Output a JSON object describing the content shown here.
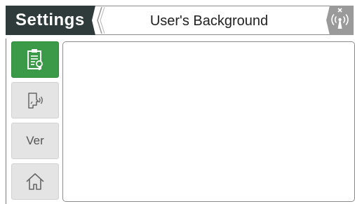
{
  "header": {
    "settings_label": "Settings",
    "page_title": "User's Background",
    "signal_icon": "signal-off-icon"
  },
  "sidebar": {
    "items": [
      {
        "icon": "clipboard-settings-icon",
        "active": true
      },
      {
        "icon": "voice-command-icon",
        "active": false
      },
      {
        "label": "Ver",
        "active": false
      },
      {
        "icon": "home-icon",
        "active": false
      }
    ]
  },
  "colors": {
    "header_dark": "#2f3a3a",
    "active_green": "#3a9a48",
    "button_gray": "#e4e4e4"
  }
}
